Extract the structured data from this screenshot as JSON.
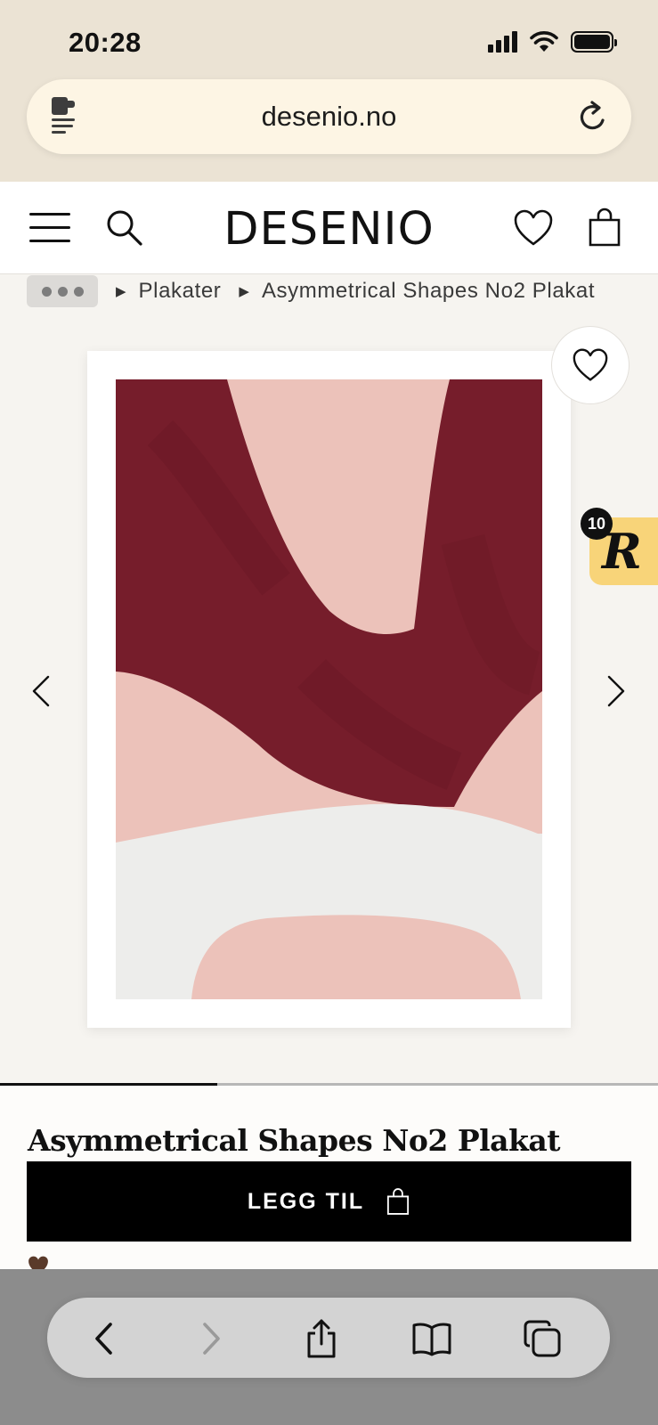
{
  "status_bar": {
    "time": "20:28",
    "icons": [
      "cellular-signal-icon",
      "wifi-icon",
      "battery-icon"
    ]
  },
  "browser": {
    "url": "desenio.no",
    "reader_icon": "reader-mode-icon",
    "reload_icon": "reload-icon"
  },
  "site_header": {
    "logo": "DESENIO",
    "menu_icon": "hamburger-menu-icon",
    "search_icon": "search-icon",
    "wishlist_icon": "heart-icon",
    "cart_icon": "shopping-bag-icon"
  },
  "breadcrumb": {
    "items": [
      "Plakater",
      "Asymmetrical Shapes No2 Plakat"
    ],
    "separator": "▶"
  },
  "gallery": {
    "image_progress": 0.33,
    "colors": {
      "burgundy": "#761d2b",
      "pink": "#ecc2ba",
      "off_white": "#ededeb"
    }
  },
  "rewards_widget": {
    "letter": "R",
    "count": "10",
    "color": "#f8d479"
  },
  "product": {
    "title": "Asymmetrical Shapes No2 Plakat",
    "add_button_label": "LEGG TIL"
  },
  "safari_toolbar": {
    "buttons": [
      "back-icon",
      "forward-icon",
      "share-icon",
      "bookmarks-icon",
      "tabs-icon"
    ]
  }
}
